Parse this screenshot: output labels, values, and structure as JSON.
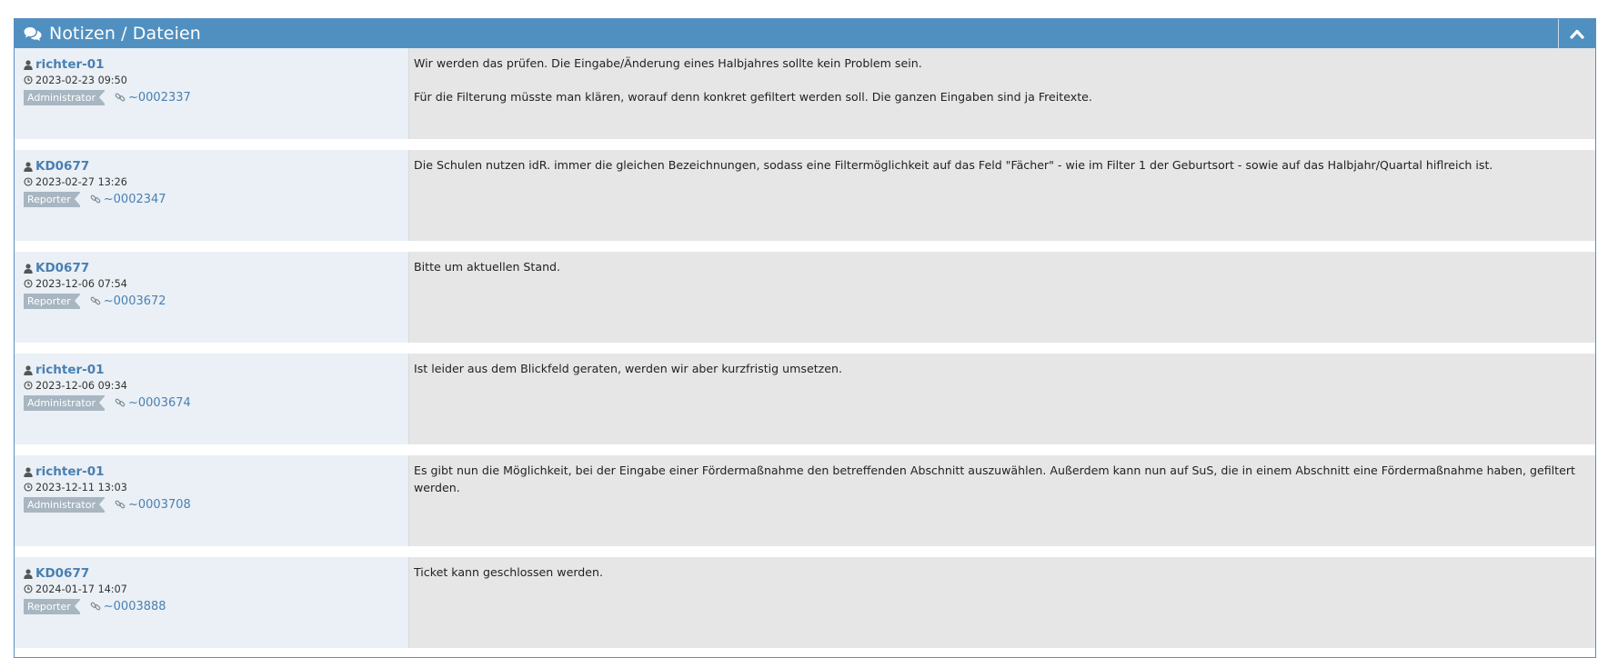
{
  "header": {
    "title": "Notizen / Dateien",
    "title_icon": "comments-icon",
    "collapse_icon": "chevron-up-icon"
  },
  "colors": {
    "header_bg": "#5090c1",
    "meta_bg": "#eaf0f5",
    "text_bg": "#e6e6e6",
    "link": "#4a7fb3",
    "badge": "#a8b6c2"
  },
  "notes": [
    {
      "user": "richter-01",
      "date": "2023-02-23 09:50",
      "role": "Administrator",
      "link": "~0002337",
      "paragraphs": [
        "Wir werden das prüfen. Die Eingabe/Änderung eines Halbjahres sollte kein Problem sein.",
        "Für die Filterung müsste man klären, worauf denn konkret gefiltert werden soll. Die ganzen Eingaben sind ja Freitexte."
      ]
    },
    {
      "user": "KD0677",
      "date": "2023-02-27 13:26",
      "role": "Reporter",
      "link": "~0002347",
      "paragraphs": [
        "Die Schulen nutzen idR. immer die gleichen Bezeichnungen, sodass eine Filtermöglichkeit auf das Feld \"Fächer\" - wie im Filter 1 der Geburtsort - sowie auf das Halbjahr/Quartal hiflreich ist."
      ]
    },
    {
      "user": "KD0677",
      "date": "2023-12-06 07:54",
      "role": "Reporter",
      "link": "~0003672",
      "paragraphs": [
        "Bitte um aktuellen Stand."
      ]
    },
    {
      "user": "richter-01",
      "date": "2023-12-06 09:34",
      "role": "Administrator",
      "link": "~0003674",
      "paragraphs": [
        "Ist leider aus dem Blickfeld geraten, werden wir aber kurzfristig umsetzen."
      ]
    },
    {
      "user": "richter-01",
      "date": "2023-12-11 13:03",
      "role": "Administrator",
      "link": "~0003708",
      "paragraphs": [
        "Es gibt nun die Möglichkeit, bei der Eingabe einer Fördermaßnahme den betreffenden Abschnitt auszuwählen. Außerdem kann nun auf SuS, die in einem Abschnitt eine Fördermaßnahme haben, gefiltert werden."
      ]
    },
    {
      "user": "KD0677",
      "date": "2024-01-17 14:07",
      "role": "Reporter",
      "link": "~0003888",
      "paragraphs": [
        "Ticket kann geschlossen werden."
      ]
    }
  ]
}
